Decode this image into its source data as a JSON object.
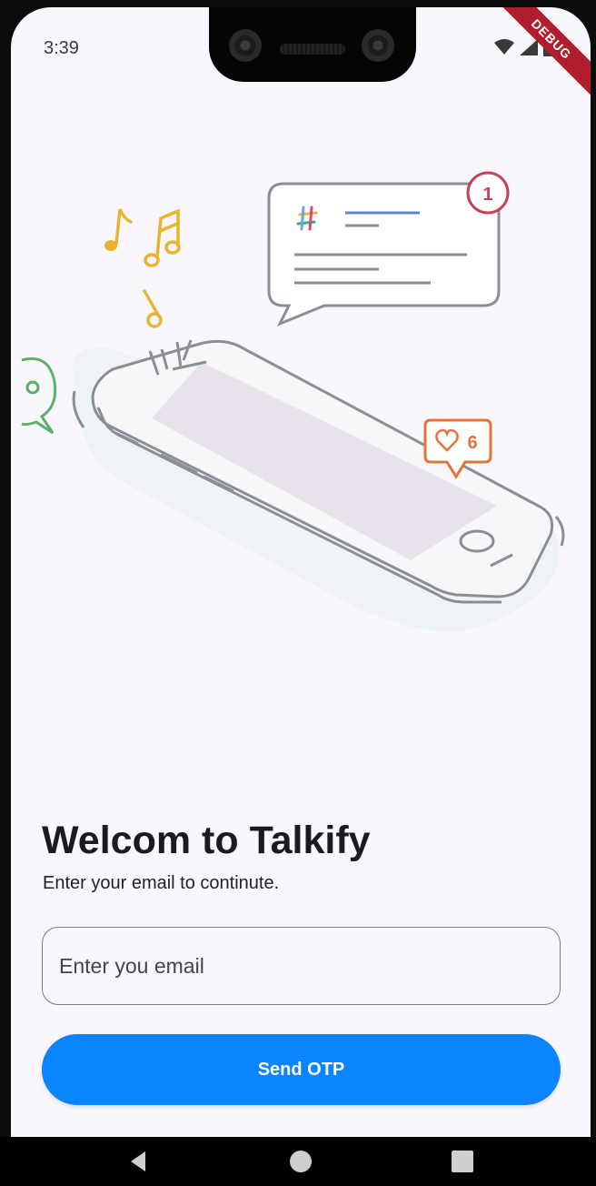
{
  "status_bar": {
    "time": "3:39",
    "icons": [
      "wifi-icon",
      "signal-icon",
      "battery-icon"
    ],
    "debug_banner": "DEBUG"
  },
  "illustration": {
    "chat_notification_count": "1",
    "like_count": "6",
    "icons": [
      "music-note-icon",
      "slack-icon",
      "heart-icon",
      "chat-bubble-icon",
      "smartphone-icon"
    ]
  },
  "welcome": {
    "title": "Welcom to Talkify",
    "subtitle": "Enter your email to continute."
  },
  "email_input": {
    "placeholder": "Enter you email",
    "value": ""
  },
  "send_button": {
    "label": "Send OTP"
  },
  "nav_bar": {
    "icons": [
      "back-icon",
      "home-icon",
      "recents-icon"
    ]
  },
  "colors": {
    "background": "#f9f7fd",
    "primary": "#0a84ff",
    "debug_ribbon": "#b01d2d"
  }
}
